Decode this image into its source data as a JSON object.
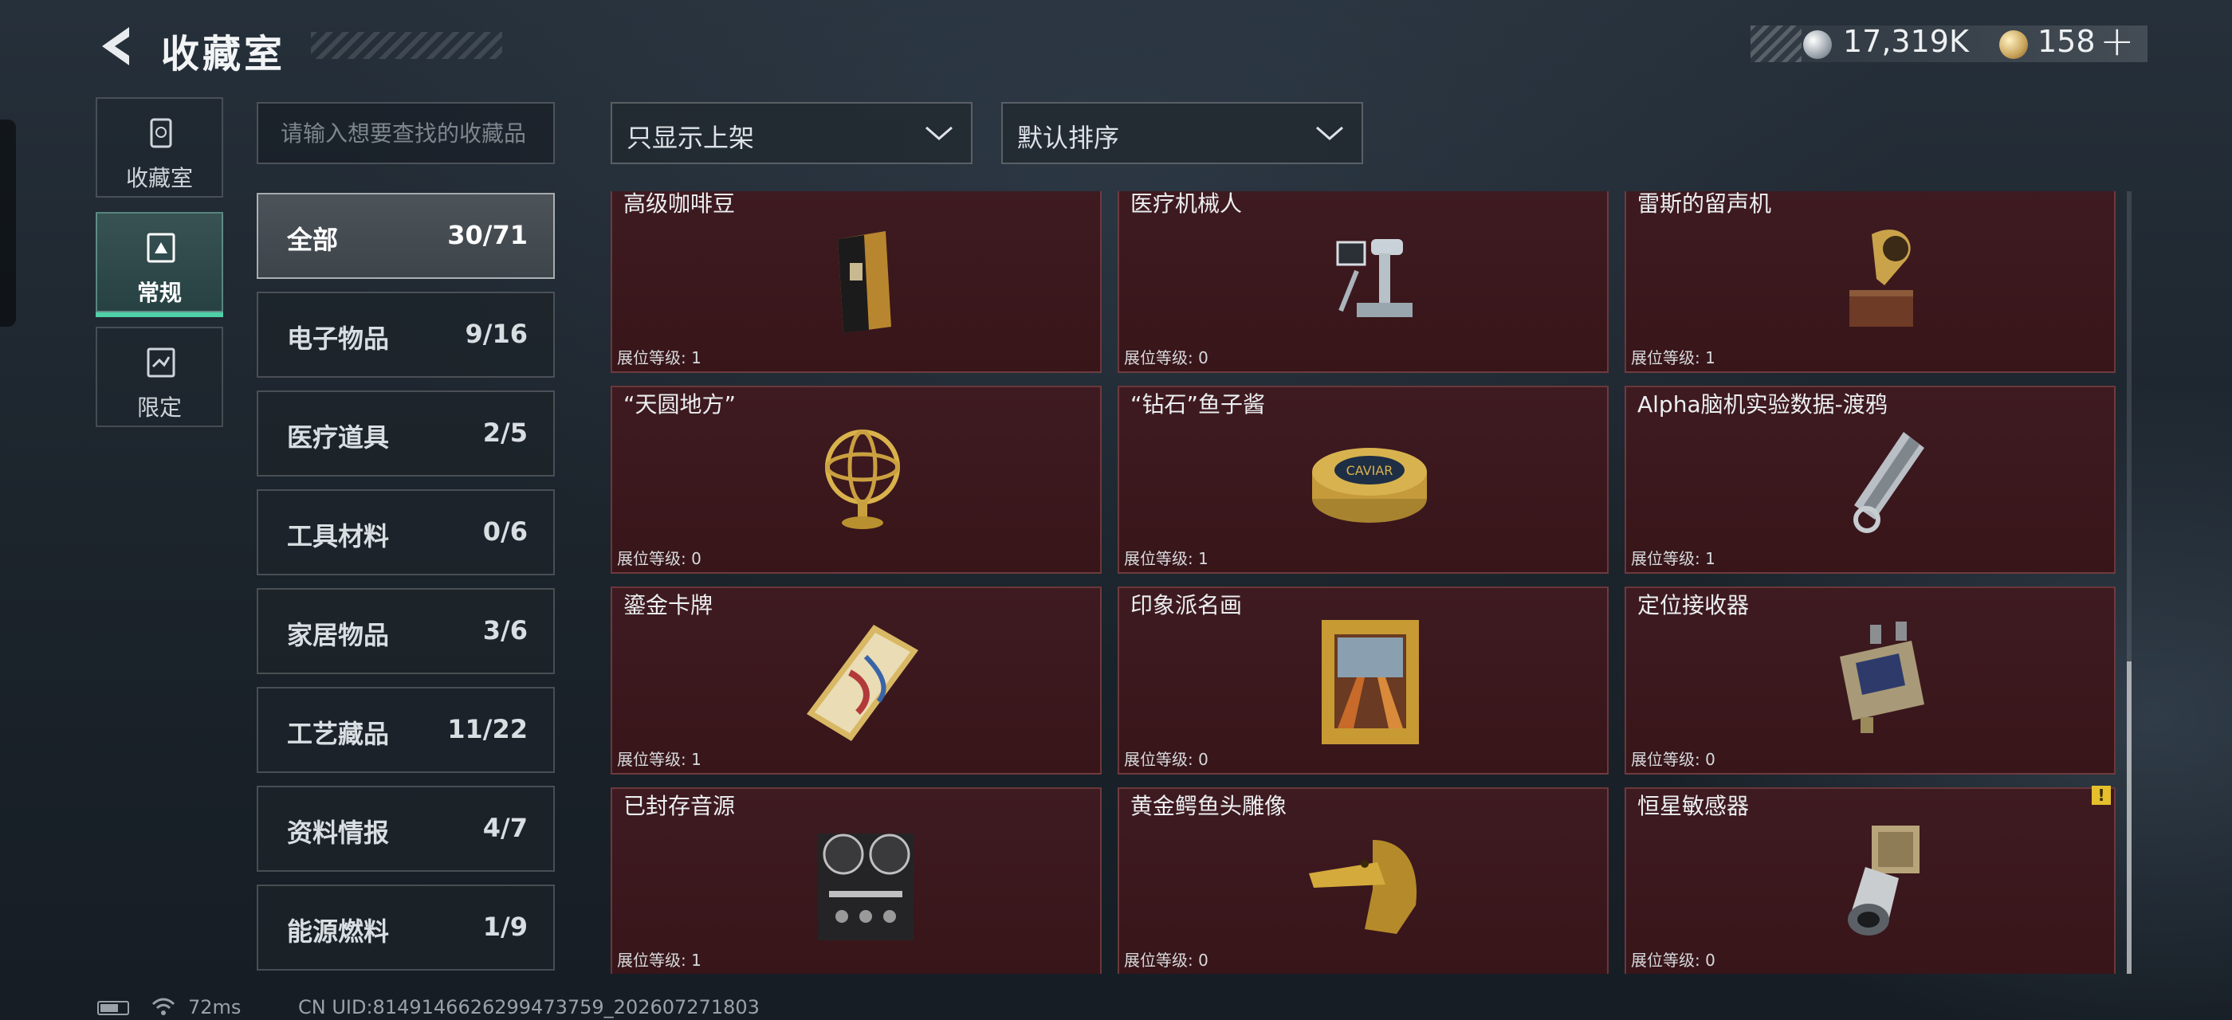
{
  "header": {
    "title": "收藏室",
    "back_icon": "back-arrow-icon",
    "currency_silver": "17,319K",
    "currency_gold": "158",
    "add_label": "+"
  },
  "nav": {
    "tabs": [
      {
        "label": "收藏室",
        "icon": "collection-icon",
        "active": false
      },
      {
        "label": "常规",
        "icon": "regular-icon",
        "active": true
      },
      {
        "label": "限定",
        "icon": "limited-icon",
        "active": false
      }
    ]
  },
  "search": {
    "placeholder": "请输入想要查找的收藏品"
  },
  "categories": [
    {
      "name": "全部",
      "count": "30/71",
      "active": true
    },
    {
      "name": "电子物品",
      "count": "9/16"
    },
    {
      "name": "医疗道具",
      "count": "2/5"
    },
    {
      "name": "工具材料",
      "count": "0/6"
    },
    {
      "name": "家居物品",
      "count": "3/6"
    },
    {
      "name": "工艺藏品",
      "count": "11/22"
    },
    {
      "name": "资料情报",
      "count": "4/7"
    },
    {
      "name": "能源燃料",
      "count": "1/9"
    }
  ],
  "filters": {
    "display": "只显示上架",
    "sort": "默认排序"
  },
  "items": [
    {
      "name": "高级咖啡豆",
      "level": "展位等级: 1",
      "icon": "coffee-bean-bag-icon"
    },
    {
      "name": "医疗机械人",
      "level": "展位等级: 0",
      "icon": "medical-robot-icon"
    },
    {
      "name": "雷斯的留声机",
      "level": "展位等级: 1",
      "icon": "gramophone-icon"
    },
    {
      "name": "“天圆地方”",
      "level": "展位等级: 0",
      "icon": "armillary-sphere-icon"
    },
    {
      "name": "“钻石”鱼子酱",
      "level": "展位等级: 1",
      "icon": "caviar-tin-icon",
      "tin_text": "CAVIAR"
    },
    {
      "name": "Alpha脑机实验数据-渡鸦",
      "level": "展位等级: 1",
      "icon": "data-drive-icon"
    },
    {
      "name": "鎏金卡牌",
      "level": "展位等级: 1",
      "icon": "gilded-card-icon"
    },
    {
      "name": "印象派名画",
      "level": "展位等级: 0",
      "icon": "framed-painting-icon"
    },
    {
      "name": "定位接收器",
      "level": "展位等级: 0",
      "icon": "locator-receiver-icon"
    },
    {
      "name": "已封存音源",
      "level": "展位等级: 1",
      "icon": "reel-recorder-icon"
    },
    {
      "name": "黄金鳄鱼头雕像",
      "level": "展位等级: 0",
      "icon": "golden-crocodile-icon"
    },
    {
      "name": "恒星敏感器",
      "level": "展位等级: 0",
      "icon": "star-sensor-icon",
      "warning": "!"
    }
  ],
  "footer": {
    "ping": "72ms",
    "uid": "CN UID:8149146626299473759_202607271803"
  }
}
